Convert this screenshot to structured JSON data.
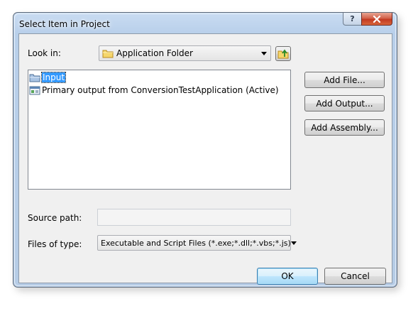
{
  "dialog": {
    "title": "Select Item in Project",
    "help_glyph": "?",
    "close_glyph": "x"
  },
  "look_in": {
    "label": "Look in:",
    "value": "Application Folder",
    "folder_icon": "folder-icon",
    "up_folder_icon": "folder-up-icon"
  },
  "items": [
    {
      "label": "Input",
      "icon": "folder-icon",
      "selected": true
    },
    {
      "label": "Primary output from ConversionTestApplication (Active)",
      "icon": "project-output-icon",
      "selected": false
    }
  ],
  "buttons": {
    "add_file": "Add File...",
    "add_output": "Add Output...",
    "add_assembly": "Add Assembly...",
    "ok": "OK",
    "cancel": "Cancel"
  },
  "source_path": {
    "label": "Source path:",
    "value": ""
  },
  "files_of_type": {
    "label": "Files of type:",
    "value": "Executable and Script Files (*.exe;*.dll;*.vbs;*.js)"
  },
  "colors": {
    "selection": "#3399ff",
    "frame": "#b8cfea",
    "client": "#f0f0f0"
  }
}
